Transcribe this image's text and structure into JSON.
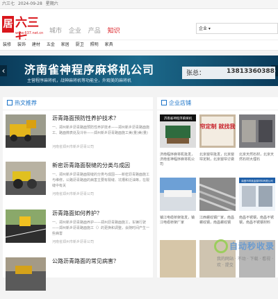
{
  "topbar": {
    "site": "六三七",
    "date": "2024-09-28",
    "weekday": "星期六"
  },
  "logo": {
    "badge": "居",
    "brand": "六三七",
    "url": "www.637.net.cn"
  },
  "mainnav": [
    "城市",
    "企业",
    "产品",
    "知识"
  ],
  "search": {
    "scope": "企业 ▾"
  },
  "catnav": [
    "装修",
    "装饰",
    "建材",
    "五金",
    "家居",
    "厨卫",
    "照明",
    "家具"
  ],
  "banner": {
    "title": "济南雀神程序麻将机公司",
    "subtitle": "主营程序麻将机，战神麻将机等功能全，外观美的麻将机",
    "contact_name": "张总：",
    "phone": "13813360388"
  },
  "hot": {
    "heading": "热文推荐"
  },
  "articles": [
    {
      "title": "沥青路面预防性养护技术？",
      "desc": "一、郑州新乡沥青路面预防性养护技术——郑州新乡沥青路面施工、路面微表处及冷补——郑州新乡沥青路面施工美(量)美(量)",
      "source": "河南省郑州市新乡沥青公司"
    },
    {
      "title": "新密沥青路面裂缝的分类与成因",
      "desc": "一、郑州新乡沥青路面裂缝的分类与成因——新密沥青路面施工与维修，公路沥青路面的病害主要有裂缝、坑槽和泛油等，在裂缝中有关",
      "source": "河南省郑州市新乡沥青公司"
    },
    {
      "title": "沥青路面如何养护？",
      "desc": "一、郑州新乡沥青路面养护——郑州沥青路面施工，车辆行驶——郑州新乡沥青路面施工（）的更换和调整，会随时间产生一些病害",
      "source": "河南省郑州市新乡沥青公司"
    },
    {
      "title": "公路沥青路面的常见病害？",
      "desc": "",
      "source": ""
    }
  ],
  "shops": {
    "heading": "企业店铺",
    "items": [
      {
        "caption": "济南程序麻将机批发，济南雀神程序麻将机公司",
        "img_text": "济南雀神程序麻将机"
      },
      {
        "caption": "北京窗帘批发，北京窗帘定制，北京窗帘订做",
        "img_text": "窗帘定制 就找我们"
      },
      {
        "caption": "北京天然石材，北京天然石材大理石",
        "img_text": ""
      },
      {
        "caption": "镇江电缆桥架批发，镇江电缆桥架厂家",
        "img_text": ""
      },
      {
        "caption": "江西螺纹钢厂家，南昌螺纹钢，南昌螺纹钢",
        "img_text": ""
      },
      {
        "caption": "南昌不锈钢，南昌不锈钢，南昌不锈钢材料",
        "img_text": "南昌市祥奥金属材料有限公司"
      }
    ]
  },
  "watermark": {
    "title": "自动秒收录",
    "subtitle": "我的网站 · 不动 · 下载 · 看视 · 欢 · 提交"
  },
  "colors": {
    "brand_red": "#d9161c",
    "link_blue": "#1a73c8",
    "banner_blue": "#0b4a6e"
  }
}
